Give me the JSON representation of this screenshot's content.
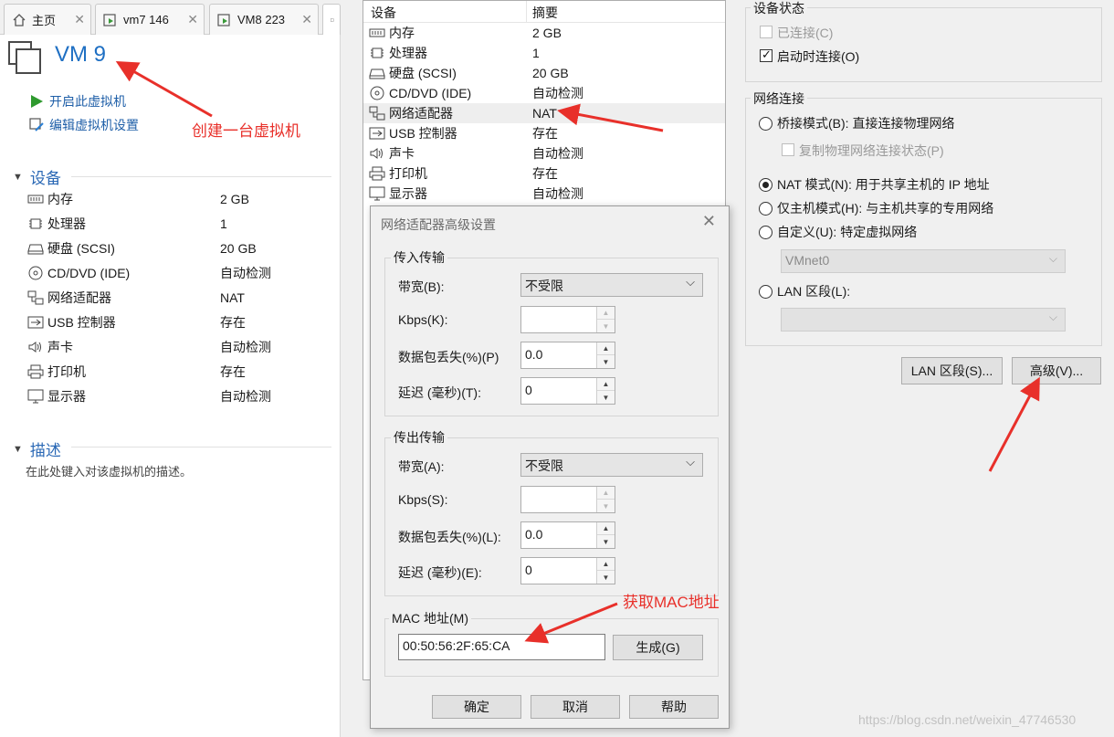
{
  "tabs": [
    {
      "label": "主页"
    },
    {
      "label": "vm7 146"
    },
    {
      "label": "VM8 223"
    }
  ],
  "vm": {
    "title": "VM 9"
  },
  "actions": {
    "power_on": "开启此虚拟机",
    "edit_settings": "编辑虚拟机设置"
  },
  "annotations": {
    "create_vm": "创建一台虚拟机",
    "get_mac": "获取MAC地址"
  },
  "devices_section": {
    "title": "设备",
    "items": [
      {
        "name": "内存",
        "value": "2 GB"
      },
      {
        "name": "处理器",
        "value": "1"
      },
      {
        "name": "硬盘 (SCSI)",
        "value": "20 GB"
      },
      {
        "name": "CD/DVD (IDE)",
        "value": "自动检测"
      },
      {
        "name": "网络适配器",
        "value": "NAT"
      },
      {
        "name": "USB 控制器",
        "value": "存在"
      },
      {
        "name": "声卡",
        "value": "自动检测"
      },
      {
        "name": "打印机",
        "value": "存在"
      },
      {
        "name": "显示器",
        "value": "自动检测"
      }
    ]
  },
  "description_section": {
    "title": "描述",
    "placeholder": "在此处键入对该虚拟机的描述。"
  },
  "settings_list": {
    "col_device": "设备",
    "col_summary": "摘要",
    "rows": [
      {
        "name": "内存",
        "value": "2 GB"
      },
      {
        "name": "处理器",
        "value": "1"
      },
      {
        "name": "硬盘 (SCSI)",
        "value": "20 GB"
      },
      {
        "name": "CD/DVD (IDE)",
        "value": "自动检测"
      },
      {
        "name": "网络适配器",
        "value": "NAT"
      },
      {
        "name": "USB 控制器",
        "value": "存在"
      },
      {
        "name": "声卡",
        "value": "自动检测"
      },
      {
        "name": "打印机",
        "value": "存在"
      },
      {
        "name": "显示器",
        "value": "自动检测"
      }
    ]
  },
  "device_status": {
    "title": "设备状态",
    "connected": {
      "label": "已连接(C)",
      "checked": false
    },
    "connect_on_start": {
      "label": "启动时连接(O)",
      "checked": true
    }
  },
  "network": {
    "title": "网络连接",
    "bridged": "桥接模式(B): 直接连接物理网络",
    "replicate": "复制物理网络连接状态(P)",
    "nat": "NAT 模式(N): 用于共享主机的 IP 地址",
    "host_only": "仅主机模式(H): 与主机共享的专用网络",
    "custom": "自定义(U): 特定虚拟网络",
    "vmnet": "VMnet0",
    "lan_segment": "LAN 区段(L):",
    "selected": "nat"
  },
  "buttons": {
    "lan_segments": "LAN 区段(S)...",
    "advanced": "高级(V)..."
  },
  "dialog": {
    "title": "网络适配器高级设置",
    "incoming": {
      "title": "传入传输",
      "bandwidth_label": "带宽(B):",
      "bandwidth_value": "不受限",
      "kbps_label": "Kbps(K):",
      "kbps_value": "",
      "loss_label": "数据包丢失(%)(P)",
      "loss_value": "0.0",
      "latency_label": "延迟 (毫秒)(T):",
      "latency_value": "0"
    },
    "outgoing": {
      "title": "传出传输",
      "bandwidth_label": "带宽(A):",
      "bandwidth_value": "不受限",
      "kbps_label": "Kbps(S):",
      "kbps_value": "",
      "loss_label": "数据包丢失(%)(L):",
      "loss_value": "0.0",
      "latency_label": "延迟 (毫秒)(E):",
      "latency_value": "0"
    },
    "mac": {
      "title": "MAC 地址(M)",
      "value": "00:50:56:2F:65:CA",
      "generate": "生成(G)"
    },
    "ok": "确定",
    "cancel": "取消",
    "help": "帮助"
  },
  "watermark": "https://blog.csdn.net/weixin_47746530"
}
